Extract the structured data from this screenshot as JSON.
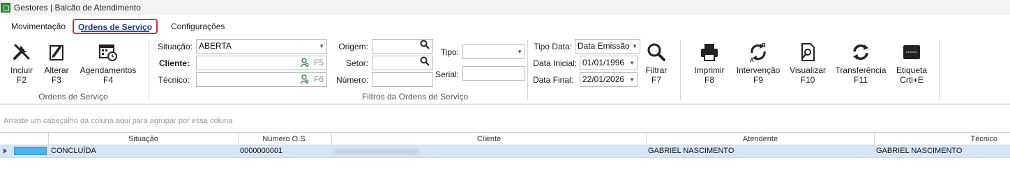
{
  "titlebar": {
    "icon": "app-logo-icon",
    "title": "Gestores |  Balcão de Atendimento"
  },
  "menu": {
    "tabs": [
      {
        "label": "Movimentação"
      },
      {
        "label": "Ordens de Serviço"
      },
      {
        "label": "Configurações"
      }
    ],
    "active": "Ordens de Serviço"
  },
  "ribbon": {
    "os_group": {
      "caption": "Ordens de Serviço",
      "incluir": {
        "label": "Incluir",
        "key": "F2",
        "icon": "tools-icon"
      },
      "alterar": {
        "label": "Alterar",
        "key": "F3",
        "icon": "edit-pencil-icon"
      },
      "agendamentos": {
        "label": "Agendamentos",
        "key": "F4",
        "icon": "calendar-clock-icon"
      }
    },
    "filters": {
      "caption": "Filtros da Ordens de Serviço",
      "situacao": {
        "label": "Situação:",
        "value": "ABERTA"
      },
      "cliente": {
        "label": "Cliente:",
        "value": "",
        "key": "F5"
      },
      "tecnico": {
        "label": "Técnico:",
        "value": "",
        "key": "F6"
      },
      "origem": {
        "label": "Origem:",
        "value": ""
      },
      "setor": {
        "label": "Setor:",
        "value": ""
      },
      "numero": {
        "label": "Número:",
        "value": ""
      },
      "tipo": {
        "label": "Tipo:",
        "value": ""
      },
      "serial": {
        "label": "Serial:",
        "value": ""
      },
      "tipo_data": {
        "label": "Tipo Data:",
        "value": "Data Emissão"
      },
      "data_inicial": {
        "label": "Data Inicial:",
        "value": "01/01/1996"
      },
      "data_final": {
        "label": "Data Final:",
        "value": "22/01/2026"
      },
      "filtrar": {
        "label": "Filtrar",
        "key": "F7",
        "icon": "magnifier-icon"
      }
    },
    "actions": {
      "imprimir": {
        "label": "Imprimir",
        "key": "F8",
        "icon": "printer-icon"
      },
      "intervencao": {
        "label": "Intervenção",
        "key": "F9",
        "icon": "refresh-ab-icon"
      },
      "visualizar": {
        "label": "Visualizar",
        "key": "F10",
        "icon": "preview-document-icon"
      },
      "transferencia": {
        "label": "Transferência",
        "key": "F11",
        "icon": "sync-arrows-icon"
      },
      "etiqueta": {
        "label": "Etiqueta",
        "key": "Crtl+E",
        "icon": "barcode-label-icon"
      }
    }
  },
  "grid": {
    "group_hint": "Arraste um cabeçalho da coluna aqui para agrupar por essa coluna",
    "columns": [
      "Situação",
      "Número O.S.",
      "Cliente",
      "Atendente",
      "Técnico"
    ],
    "rows": [
      {
        "situacao": "CONCLUÍDA",
        "numero": "0000000001",
        "cliente": "",
        "atendente": "GABRIEL NASCIMENTO",
        "tecnico": "GABRIEL NASCIMENTO",
        "status_color": "#4db3f0"
      }
    ]
  }
}
